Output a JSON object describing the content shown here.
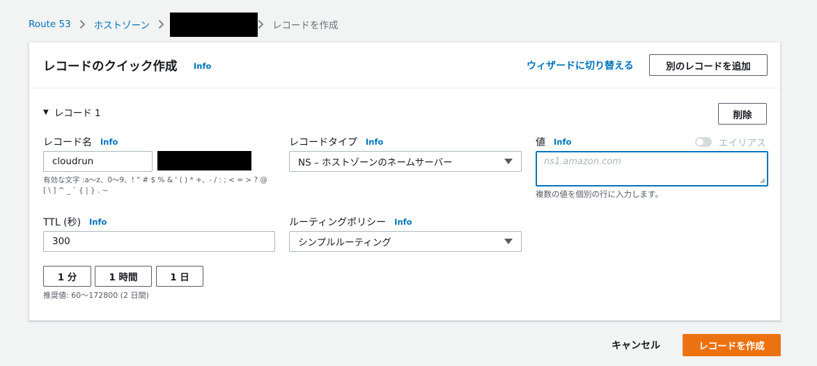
{
  "breadcrumb": {
    "items": [
      "Route 53",
      "ホストゾーン"
    ],
    "current": "レコードを作成"
  },
  "header": {
    "title": "レコードのクイック作成",
    "info": "Info",
    "switch_wizard": "ウィザードに切り替える",
    "add_record": "別のレコードを追加"
  },
  "record": {
    "toggle_label": "レコード 1",
    "delete": "削除",
    "name": {
      "label": "レコード名",
      "info": "Info",
      "value": "cloudrun",
      "hint_line1": "有効な文字 :a〜z、0〜9、! \" # $ % & ' ( ) * +、- / : ; < = > ? @",
      "hint_line2": "[ \\ ] ^ _ ` { | } . ~"
    },
    "type": {
      "label": "レコードタイプ",
      "info": "Info",
      "value": "NS – ホストゾーンのネームサーバー"
    },
    "value": {
      "label": "値",
      "info": "Info",
      "placeholder": "ns1.amazon.com",
      "hint": "複数の値を個別の行に入力します。",
      "alias_label": "エイリアス",
      "alias_enabled": false
    },
    "ttl": {
      "label": "TTL (秒)",
      "info": "Info",
      "value": "300",
      "buttons": [
        "1 分",
        "1 時間",
        "1 日"
      ],
      "hint": "推奨値: 60〜172800 (2 日間)"
    },
    "routing": {
      "label": "ルーティングポリシー",
      "info": "Info",
      "value": "シンプルルーティング"
    }
  },
  "footer": {
    "cancel": "キャンセル",
    "create": "レコードを作成"
  },
  "colors": {
    "link": "#0073bb",
    "primary_button": "#ec7211",
    "background": "#f2f3f3"
  }
}
